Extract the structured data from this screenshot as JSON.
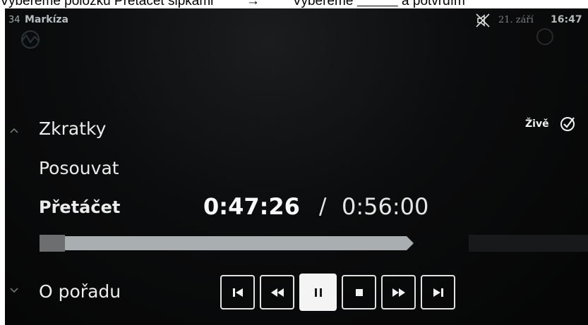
{
  "caption": {
    "left": "Vybereme položku Přetáčet šipkami",
    "arrow": "→",
    "right_prefix": "Vybereme",
    "right_underlined": "      ",
    "right_suffix": "a potvrdím"
  },
  "status_bar": {
    "channel_number": "34",
    "channel_name": "Markíza",
    "date": "21. září",
    "time": "16:47"
  },
  "menu": {
    "items": [
      {
        "label": "Zkratky"
      },
      {
        "label": "Posouvat"
      },
      {
        "label": "Přetáčet",
        "active": true
      },
      {
        "label": "O pořadu"
      }
    ]
  },
  "live": {
    "label": "Živě"
  },
  "playback": {
    "current_time": "0:47:26",
    "separator": "/",
    "total_time": "0:56:00",
    "progress_fraction": 0.847
  },
  "controls": [
    {
      "name": "skip-back",
      "active": false
    },
    {
      "name": "rewind",
      "active": false
    },
    {
      "name": "pause",
      "active": true
    },
    {
      "name": "stop",
      "active": false
    },
    {
      "name": "fast-forward",
      "active": false
    },
    {
      "name": "skip-forward",
      "active": false
    }
  ],
  "colors": {
    "background": "#0b0c0d",
    "text": "#ececec",
    "progress": "#a9aeb1",
    "control_border": "#e2e2e2"
  }
}
